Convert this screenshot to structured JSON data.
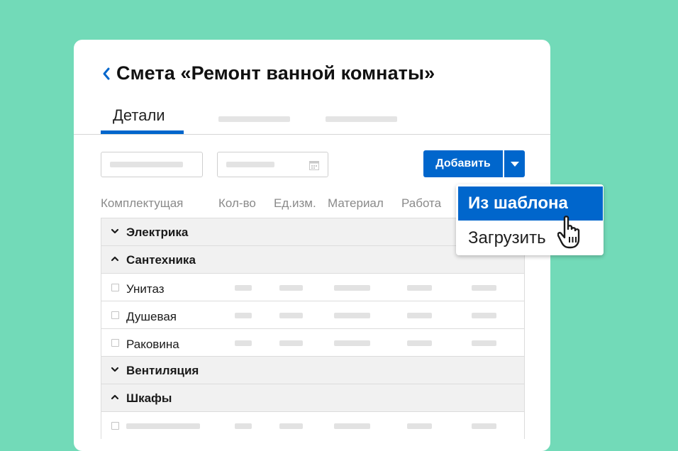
{
  "header": {
    "title": "Смета «Ремонт ванной комнаты»"
  },
  "tabs": {
    "active_label": "Детали"
  },
  "toolbar": {
    "add_label": "Добавить"
  },
  "columns": [
    "Комплектущая",
    "Кол-во",
    "Ед.изм.",
    "Материал",
    "Работа"
  ],
  "groups": {
    "electrics": "Электрика",
    "plumbing": "Сантехника",
    "ventilation": "Вентиляция",
    "cabinets": "Шкафы"
  },
  "items": {
    "toilet": "Унитаз",
    "shower": "Душевая",
    "sink": "Раковина"
  },
  "menu": {
    "from_template": "Из шаблона",
    "upload": "Загрузить"
  },
  "colors": {
    "background": "#72dab8",
    "accent": "#0066cc"
  }
}
